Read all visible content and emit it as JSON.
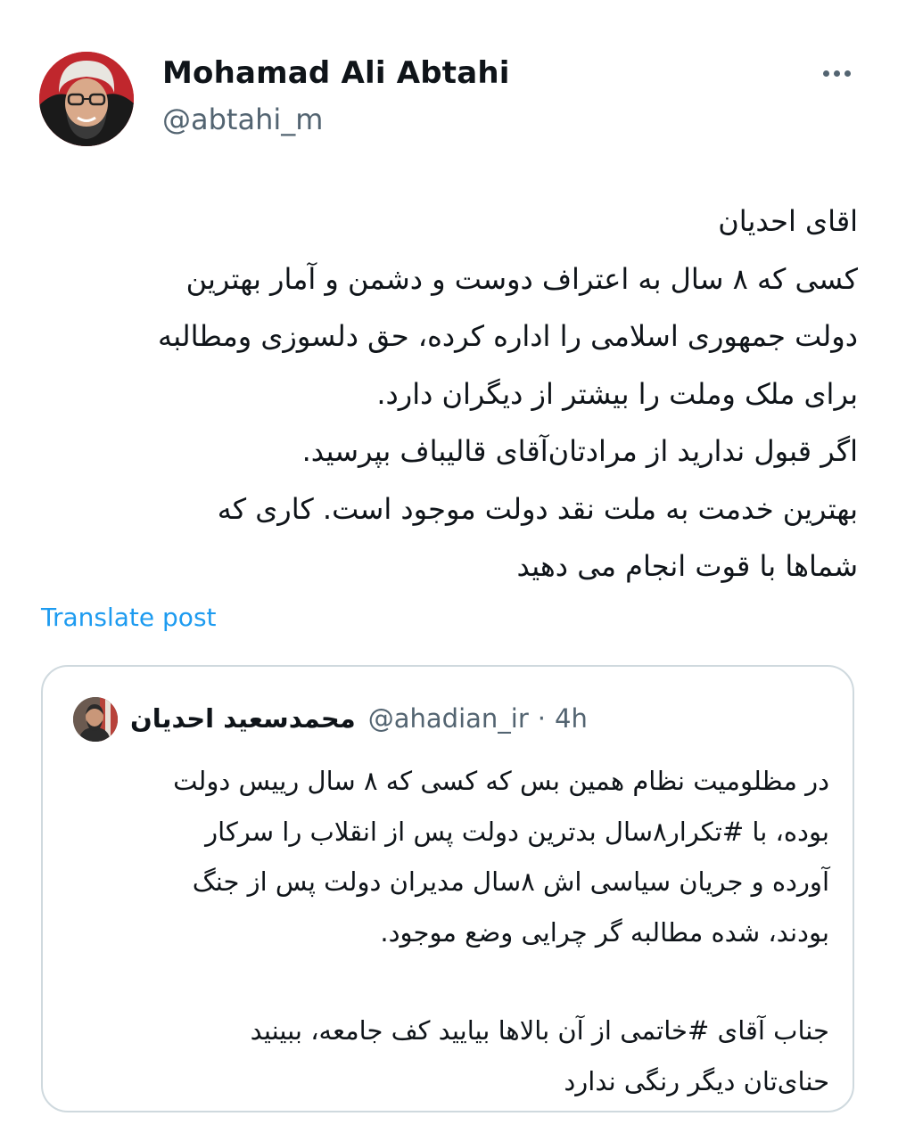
{
  "post": {
    "author_name": "Mohamad Ali Abtahi",
    "author_handle": "@abtahi_m",
    "more_label": "More options",
    "lines": [
      "اقای احدیان",
      "کسی که ۸ سال به اعتراف دوست و دشمن و آمار بهترین",
      "دولت جمهوری اسلامی را اداره کرده، حق دلسوزی ومطالبه",
      "برای ملک وملت را بیشتر از دیگران دارد.",
      "اگر قبول ندارید از مرادتان‌آقای قالیباف بپرسید.",
      "بهترین خدمت به ملت نقد دولت موجود است. کاری که",
      "شماها با قوت انجام می دهید"
    ],
    "translate_label": "Translate post"
  },
  "quote": {
    "author_name": "محمدسعید احدیان",
    "author_handle": "@ahadian_ir",
    "separator": "·",
    "time": "4h",
    "paragraph1": [
      "در مظلومیت نظام همین بس که کسی که  ۸ سال رییس دولت",
      "بوده، با #تکرار۸سال بدترین دولت پس از انقلاب را سرکار",
      "آورده و جریان سیاسی اش  ۸سال مدیران  دولت پس از جنگ",
      "بودند، شده مطالبه گر چرایی وضع موجود."
    ],
    "paragraph2": [
      "جناب آقای #خاتمی از آن بالاها بیایید کف جامعه، ببینید",
      "حنای‌تان دیگر رنگی ندارد"
    ]
  },
  "colors": {
    "text": "#0f1419",
    "secondary": "#536471",
    "link": "#1d9bf0",
    "border": "#cfd9de",
    "avatar_bg": "#c0272d"
  },
  "icons": {
    "more": "more-horizontal-icon"
  }
}
